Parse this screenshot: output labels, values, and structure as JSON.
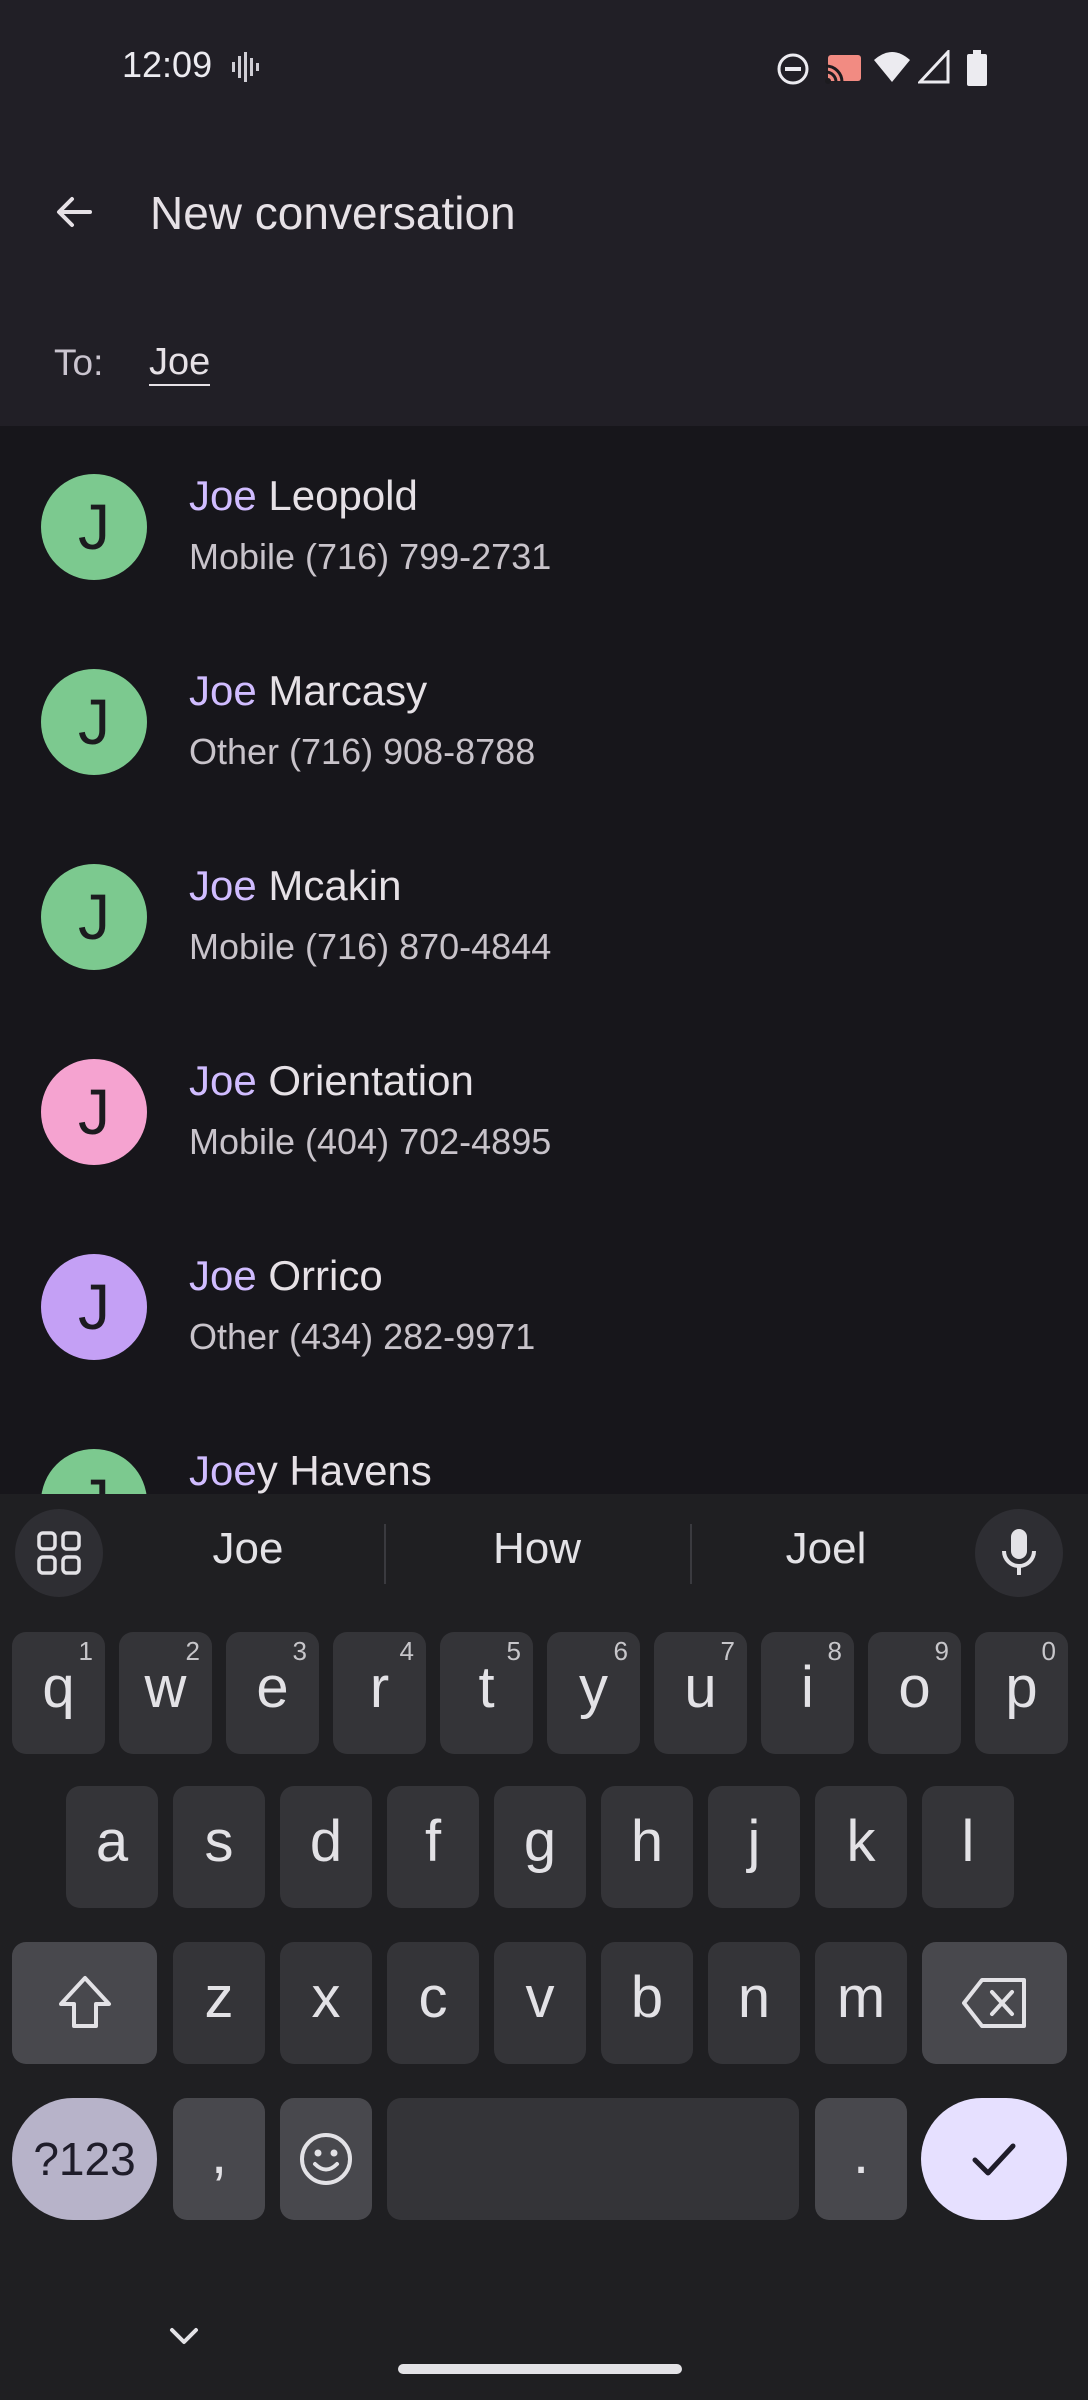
{
  "status": {
    "time": "12:09"
  },
  "header": {
    "title": "New conversation",
    "to_label": "To:",
    "to_value": "Joe"
  },
  "contacts": [
    {
      "initial": "J",
      "match": "Joe",
      "rest": " Leopold",
      "phone": "Mobile (716) 799-2731",
      "color": "#7cc98f"
    },
    {
      "initial": "J",
      "match": "Joe",
      "rest": " Marcasy",
      "phone": "Other (716) 908-8788",
      "color": "#7cc98f"
    },
    {
      "initial": "J",
      "match": "Joe",
      "rest": " Mcakin",
      "phone": "Mobile (716) 870-4844",
      "color": "#7cc98f"
    },
    {
      "initial": "J",
      "match": "Joe",
      "rest": " Orientation",
      "phone": "Mobile (404) 702-4895",
      "color": "#f5a3d0"
    },
    {
      "initial": "J",
      "match": "Joe",
      "rest": " Orrico",
      "phone": "Other (434) 282-9971",
      "color": "#c4a0f5"
    },
    {
      "initial": "J",
      "match": "Joe",
      "rest": "y Havens",
      "phone": "",
      "color": "#7cc98f"
    }
  ],
  "keyboard": {
    "suggestions": [
      "Joe",
      "How",
      "Joel"
    ],
    "row1": [
      {
        "k": "q",
        "h": "1"
      },
      {
        "k": "w",
        "h": "2"
      },
      {
        "k": "e",
        "h": "3"
      },
      {
        "k": "r",
        "h": "4"
      },
      {
        "k": "t",
        "h": "5"
      },
      {
        "k": "y",
        "h": "6"
      },
      {
        "k": "u",
        "h": "7"
      },
      {
        "k": "i",
        "h": "8"
      },
      {
        "k": "o",
        "h": "9"
      },
      {
        "k": "p",
        "h": "0"
      }
    ],
    "row2": [
      "a",
      "s",
      "d",
      "f",
      "g",
      "h",
      "j",
      "k",
      "l"
    ],
    "row3": [
      "z",
      "x",
      "c",
      "v",
      "b",
      "n",
      "m"
    ],
    "symbols_label": "?123",
    "comma": ",",
    "period": "."
  }
}
